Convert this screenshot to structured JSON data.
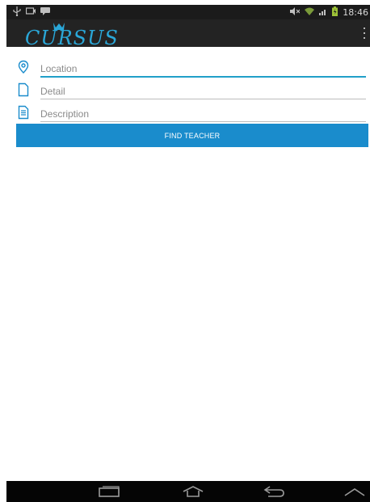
{
  "status_bar": {
    "time": "18:46",
    "icons": [
      "usb-icon",
      "screen-icon",
      "chat-icon",
      "mute-icon",
      "wifi-icon",
      "signal-icon",
      "battery-icon"
    ]
  },
  "app_bar": {
    "logo_text": "CURSUS",
    "overflow_icon": "overflow-menu-icon",
    "accent_color": "#2aa7d8"
  },
  "form": {
    "location": {
      "placeholder": "Location",
      "icon": "location-pin-icon"
    },
    "detail": {
      "placeholder": "Detail",
      "icon": "document-icon"
    },
    "description": {
      "placeholder": "Description",
      "icon": "description-icon"
    },
    "find_button_label": "FIND TEACHER",
    "button_color": "#1a8ccc",
    "underline_focus_color": "#21a0c9"
  },
  "nav_bar": {
    "items": [
      "recents-icon",
      "home-icon",
      "back-icon",
      "up-icon"
    ]
  }
}
